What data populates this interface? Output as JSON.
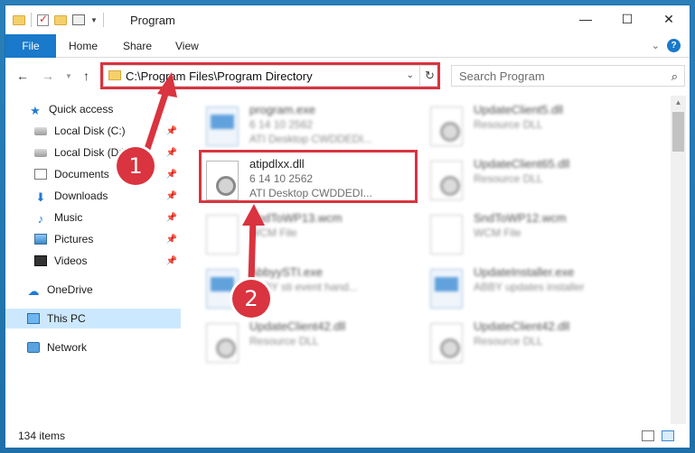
{
  "window": {
    "title": "Program",
    "controls": [
      "—",
      "☐",
      "✕"
    ]
  },
  "ribbon": {
    "tabs": [
      "File",
      "Home",
      "Share",
      "View"
    ]
  },
  "address": {
    "path": "C:\\Program Files\\Program Directory",
    "search_placeholder": "Search Program"
  },
  "sidebar": {
    "items": [
      {
        "label": "Quick access",
        "icon": "star-icon"
      },
      {
        "label": "Local Disk (C:)",
        "icon": "disk-icon"
      },
      {
        "label": "Local Disk (D:)",
        "icon": "disk-icon"
      },
      {
        "label": "Documents",
        "icon": "documents-icon"
      },
      {
        "label": "Downloads",
        "icon": "downloads-icon"
      },
      {
        "label": "Music",
        "icon": "music-icon"
      },
      {
        "label": "Pictures",
        "icon": "pictures-icon"
      },
      {
        "label": "Videos",
        "icon": "videos-icon"
      },
      {
        "label": "OneDrive",
        "icon": "onedrive-icon"
      },
      {
        "label": "This PC",
        "icon": "pc-icon"
      },
      {
        "label": "Network",
        "icon": "network-icon"
      }
    ]
  },
  "files": [
    {
      "name": "program.exe",
      "line1": "6 14 10 2562",
      "line2": "ATI Desktop CWDDEDI...",
      "type": "exe"
    },
    {
      "name": "UpdateClient5.dll",
      "line1": "Resource DLL",
      "line2": "",
      "type": "dll"
    },
    {
      "name": "atipdlxx.dll",
      "line1": "6 14 10 2562",
      "line2": "ATI Desktop CWDDEDI...",
      "type": "dll"
    },
    {
      "name": "UpdateClient65.dll",
      "line1": "Resource DLL",
      "line2": "",
      "type": "dll"
    },
    {
      "name": "SndToWP13.wcm",
      "line1": "WCM File",
      "line2": "",
      "type": "wcm"
    },
    {
      "name": "SndToWP12.wcm",
      "line1": "WCM File",
      "line2": "",
      "type": "wcm"
    },
    {
      "name": "AbbyySTI.exe",
      "line1": "ABBY sti event hand...",
      "line2": "",
      "type": "exe"
    },
    {
      "name": "UpdateInstaller.exe",
      "line1": "ABBY updates installer",
      "line2": "",
      "type": "exe"
    },
    {
      "name": "UpdateClient42.dll",
      "line1": "Resource DLL",
      "line2": "",
      "type": "dll"
    },
    {
      "name": "UpdateClient42.dll",
      "line1": "Resource DLL",
      "line2": "",
      "type": "dll"
    }
  ],
  "status": {
    "item_count": "134 items"
  },
  "callouts": [
    "1",
    "2"
  ],
  "colors": {
    "accent": "#1979ca",
    "highlight": "#d9343f",
    "selected": "#cce8ff"
  }
}
